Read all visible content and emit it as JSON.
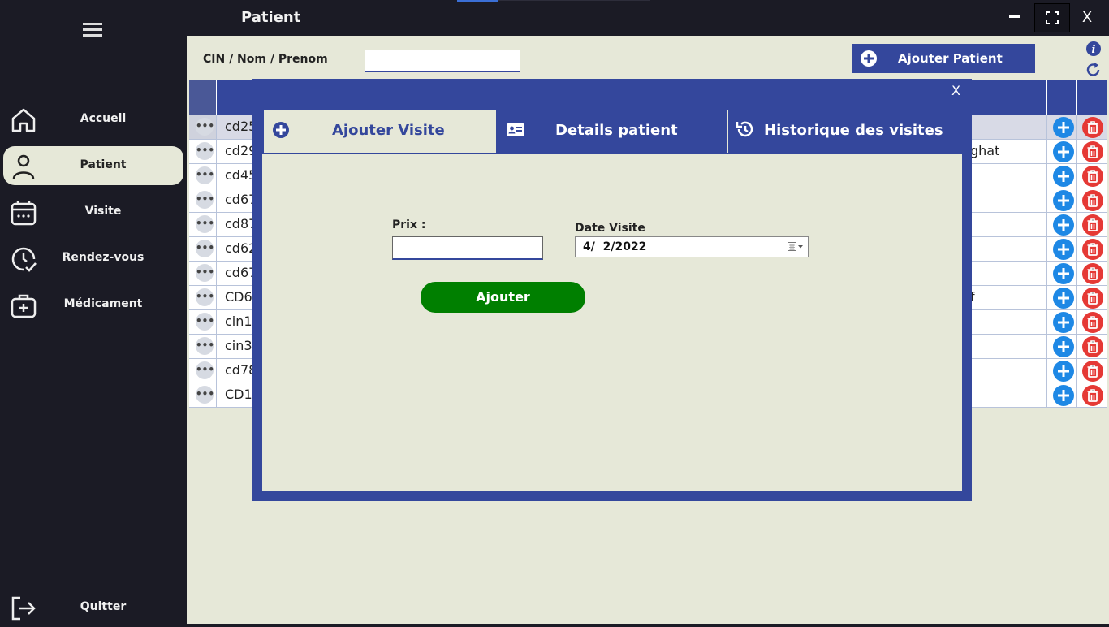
{
  "window": {
    "title": "Patient",
    "close_label": "X"
  },
  "sidebar": {
    "items": [
      {
        "label": "Accueil",
        "icon": "home-icon"
      },
      {
        "label": "Patient",
        "icon": "person-icon",
        "active": true
      },
      {
        "label": "Visite",
        "icon": "calendar-icon"
      },
      {
        "label": "Rendez-vous",
        "icon": "clock-check-icon"
      },
      {
        "label": "Médicament",
        "icon": "medkit-icon"
      }
    ],
    "quit_label": "Quitter"
  },
  "search": {
    "label": "CIN / Nom / Prenom",
    "value": ""
  },
  "toolbar": {
    "add_patient_label": "Ajouter Patient"
  },
  "table": {
    "rows": [
      {
        "cin": "cd25",
        "tail": ""
      },
      {
        "cin": "cd29",
        "tail": "ghat"
      },
      {
        "cin": "cd45",
        "tail": ""
      },
      {
        "cin": "cd67",
        "tail": ""
      },
      {
        "cin": "cd87",
        "tail": ""
      },
      {
        "cin": "cd62",
        "tail": ""
      },
      {
        "cin": "cd67",
        "tail": ""
      },
      {
        "cin": "CD6",
        "tail": "f"
      },
      {
        "cin": "cin1",
        "tail": ""
      },
      {
        "cin": "cin3",
        "tail": ""
      },
      {
        "cin": "cd78",
        "tail": ""
      },
      {
        "cin": "CD1",
        "tail": ""
      }
    ]
  },
  "modal": {
    "close_label": "X",
    "tabs": [
      {
        "label": "Ajouter Visite",
        "icon": "plus-circle-icon",
        "active": true
      },
      {
        "label": "Details patient",
        "icon": "id-card-icon"
      },
      {
        "label": "Historique des visites",
        "icon": "history-icon"
      }
    ],
    "prix_label": "Prix :",
    "prix_value": "",
    "date_label": "Date Visite",
    "date_value": "4/  2/2022",
    "submit_label": "Ajouter"
  },
  "colors": {
    "primary": "#34479c",
    "success": "#007f00",
    "danger": "#e53935",
    "accent": "#1e88e5",
    "background": "#e6e8d8",
    "sidebar": "#1b1b25"
  }
}
